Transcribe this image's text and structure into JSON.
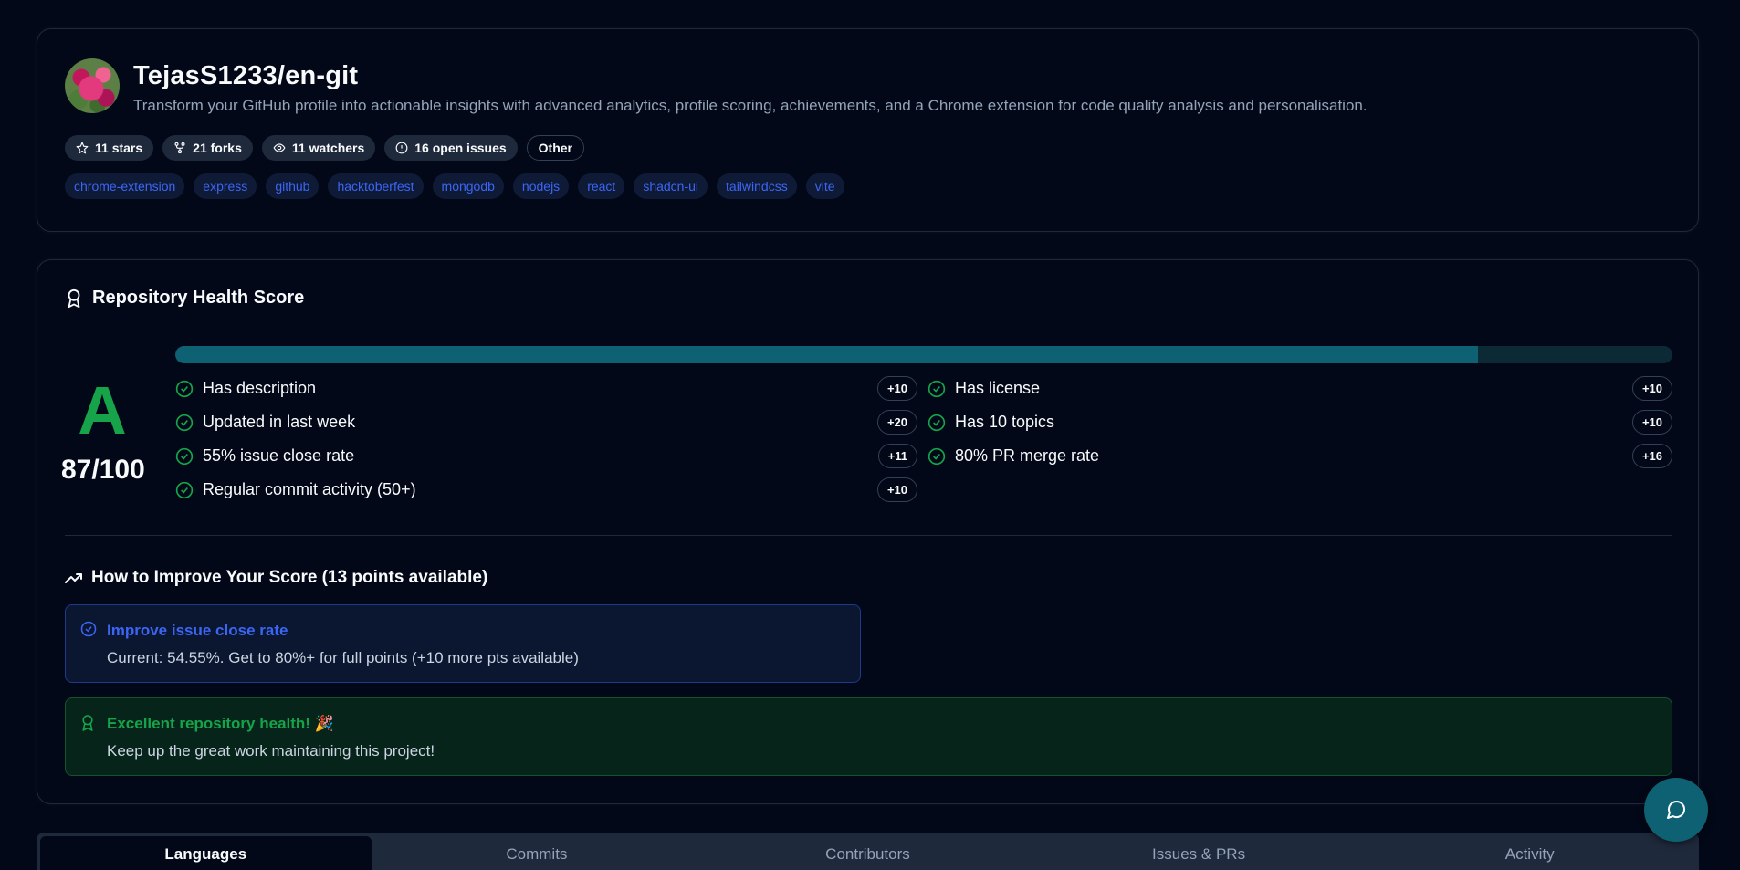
{
  "repo": {
    "title": "TejasS1233/en-git",
    "description": "Transform your GitHub profile into actionable insights with advanced analytics, profile scoring, achievements, and a Chrome extension for code quality analysis and personalisation.",
    "stats": [
      {
        "icon": "star-icon",
        "label": "11 stars"
      },
      {
        "icon": "fork-icon",
        "label": "21 forks"
      },
      {
        "icon": "eye-icon",
        "label": "11 watchers"
      },
      {
        "icon": "info-circle-icon",
        "label": "16 open issues"
      }
    ],
    "language_badge": "Other",
    "topics": [
      "chrome-extension",
      "express",
      "github",
      "hacktoberfest",
      "mongodb",
      "nodejs",
      "react",
      "shadcn-ui",
      "tailwindcss",
      "vite"
    ]
  },
  "health": {
    "title": "Repository Health Score",
    "grade": "A",
    "score_text": "87/100",
    "score_fraction": 0.87,
    "criteria_left": [
      {
        "label": "Has description",
        "points": "+10"
      },
      {
        "label": "Updated in last week",
        "points": "+20"
      },
      {
        "label": "55% issue close rate",
        "points": "+11"
      },
      {
        "label": "Regular commit activity (50+)",
        "points": "+10"
      }
    ],
    "criteria_right": [
      {
        "label": "Has license",
        "points": "+10"
      },
      {
        "label": "Has 10 topics",
        "points": "+10"
      },
      {
        "label": "80% PR merge rate",
        "points": "+16"
      }
    ],
    "improve_title": "How to Improve Your Score (13 points available)",
    "tip": {
      "title": "Improve issue close rate",
      "text": "Current: 54.55%. Get to 80%+ for full points (+10 more pts available)"
    },
    "success": {
      "title": "Excellent repository health! 🎉",
      "text": "Keep up the great work maintaining this project!"
    }
  },
  "tabs": [
    "Languages",
    "Commits",
    "Contributors",
    "Issues & PRs",
    "Activity"
  ],
  "active_tab": "Languages",
  "colors": {
    "background": "#020817",
    "accent_teal": "#0e6173",
    "grade_green": "#16a34a",
    "topic_blue": "#3b66f5"
  }
}
